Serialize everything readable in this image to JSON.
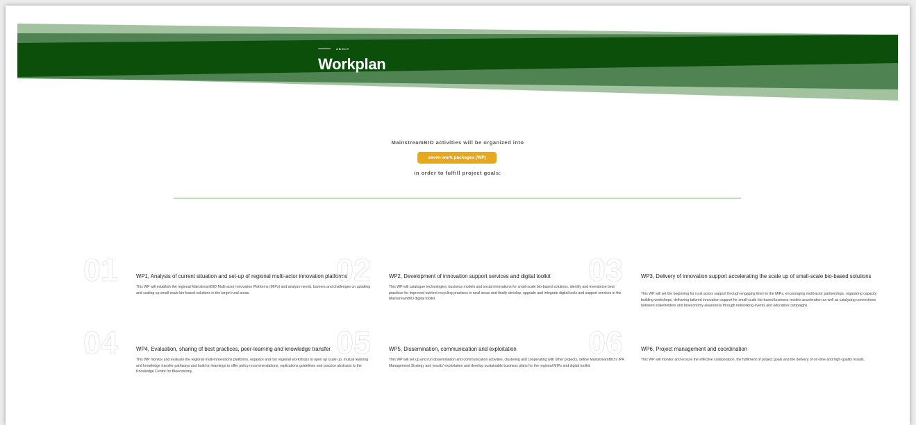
{
  "hero": {
    "eyebrow": "ABOUT",
    "title": "Workplan",
    "colors": {
      "dark": "#0b4f0b",
      "mid": "#4f8352",
      "light": "#a3c3a0"
    }
  },
  "intro": {
    "line1": "MainstreamBIO activities will be organized into",
    "highlight": "seven work packages (WP)",
    "line3": "in order to fulfill project goals:",
    "accent_color": "#e6a81c"
  },
  "work_packages": [
    {
      "number": "01",
      "title": "WP1, Analysis of current situation and set-up of regional multi-actor innovation platforms",
      "description": "This WP will establish the regional MainstreamBIO Multi-actor Innovation Platforms (MIPs) and analyze needs, barriers and challenges on uptaking and scaling up small-scale bio-based solutions in the target rural areas."
    },
    {
      "number": "02",
      "title": "WP2, Development of innovation support services and digital toolkit",
      "description": "This WP will catalogue technologies, business models and social innovations for small-scale bio-based solutions, identify and inventorise best practices for improved nutrient recycling practices in rural areas and finally develop, upgrade and integrate digital tools and support services in the MainstreamBIO digital toolkit."
    },
    {
      "number": "03",
      "title": "WP3, Delivery of innovation support accelerating the scale up of small-scale bio-based solutions",
      "description": "This WP will set the beginning for rural actors support through engaging them in the MIPs, encouraging multi-actor partnerships, organizing capacity building workshops, delivering tailored innovation support for small-scale bio-based business models acceleration as well as catalyzing connections between stakeholders and bioeconomy awareness through networking events and education campaigns."
    },
    {
      "number": "04",
      "title": "WP4, Evaluation, sharing of best practices, peer-learning and knowledge transfer",
      "description": "This WP monitor and evaluate the regional multi-innovations platforms, organize and run regional workshops to open up scale up, mutual learning and knowledge transfer pathways and build on learnings to offer policy recommendations, replications guidelines and practice abstracts to the Knowledge Centre for Bioeconomy."
    },
    {
      "number": "05",
      "title": "WP5, Dissemination, communication and exploitation",
      "description": "This WP will set up and run dissemination and communication activities, clustering and cooperating with other projects, define MainstreamBIO's IPR Management Strategy and results' exploitation and develop sustainable business plans for the regional MIPs and digital toolkit."
    },
    {
      "number": "06",
      "title": "WP6, Project management and coordination",
      "description": "This WP will monitor and ensure the effective collaboration, the fulfilment of project goals and the delivery of on-time and high-quality results."
    }
  ]
}
